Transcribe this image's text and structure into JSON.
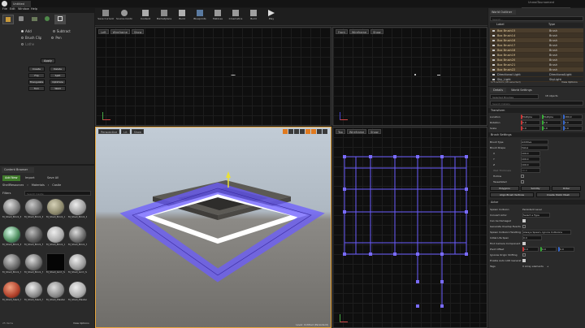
{
  "app": {
    "tab_title": "Untitled",
    "project_name": "UnrealTournament",
    "search_placeholder": "Search For Help"
  },
  "menu": [
    "File",
    "Edit",
    "Window",
    "Help"
  ],
  "toolbar": {
    "buttons": [
      "Save Current",
      "Source Control",
      "Content",
      "Marketplace",
      "Build",
      "Blueprints",
      "Matinee",
      "Cinematics",
      "Build",
      "Play"
    ]
  },
  "modes_panel": {
    "title": "Modes",
    "brush_options": [
      "Add",
      "Subtract",
      "Brush Clip",
      "Pen",
      "Lathe"
    ],
    "apply_label": "Apply",
    "buttons": [
      "Create",
      "Delete",
      "Flip",
      "Split",
      "Triangulate",
      "Optimize",
      "Turn",
      "Weld"
    ]
  },
  "content_browser": {
    "title": "Content Browser",
    "add_new_label": "Add New",
    "import_label": "Import",
    "save_all_label": "Save All",
    "path": [
      "ShellResources",
      "Materials",
      "Castle"
    ],
    "filters_label": "Filters",
    "search_placeholder": "Search Castle",
    "assets": [
      "M_Shell_Brick_B",
      "M_Shell_Brick_B",
      "M_Shell_Brick_C",
      "M_Shell_Brick_D",
      "M_Shell_Brick_E",
      "M_Shell_Brick_F",
      "M_Shell_Brick_G",
      "M_Shell_Brick_H",
      "M_Shell_Brick_Hpoptimize",
      "M_Shell_Brick_Stone",
      "M_Shell_Grnt_Slab_01",
      "M_Shell_Grnt_Slab_02",
      "M_Shell_Slant_Stab_01",
      "M_Shell_Slant_Slab_01_Sealed",
      "M_Shell_Plaster",
      "M_Shell_Plaster_Small",
      "M_Shell_Plaster",
      "M_Shell_Plaster_Stat",
      "M_Shell_Plaster",
      "M_Shell_Plaster_B"
    ],
    "item_count": "25 items",
    "view_options": "View Options"
  },
  "viewports": {
    "top_left": {
      "name": "Left",
      "mode": "Wireframe",
      "show": "Show"
    },
    "top_right": {
      "name": "Front",
      "mode": "Wireframe",
      "show": "Show"
    },
    "bottom_left": {
      "name": "Perspective",
      "mode": "Lit",
      "show": "Show",
      "level_text": "Level: Untitled (Persistent)"
    },
    "bottom_right": {
      "name": "Top",
      "mode": "Wireframe",
      "show": "Show"
    }
  },
  "world_outliner": {
    "title": "World Outliner",
    "search_placeholder": "Search...",
    "col_label": "Label",
    "col_type": "Type",
    "rows": [
      {
        "label": "Box Brush15",
        "type": "Brush"
      },
      {
        "label": "Box Brush14",
        "type": "Brush"
      },
      {
        "label": "Box Brush16",
        "type": "Brush"
      },
      {
        "label": "Box Brush17",
        "type": "Brush"
      },
      {
        "label": "Box Brush18",
        "type": "Brush"
      },
      {
        "label": "Box Brush19",
        "type": "Brush"
      },
      {
        "label": "Box Brush20",
        "type": "Brush"
      },
      {
        "label": "Box Brush21",
        "type": "Brush"
      },
      {
        "label": "Box Brush22",
        "type": "Brush"
      },
      {
        "label": "Directional Light",
        "type": "DirectionalLight"
      },
      {
        "label": "Sky_Light",
        "type": "SkyLight"
      }
    ],
    "count": "175 actors (18 selected)",
    "view_options": "View Options"
  },
  "details": {
    "tabs": [
      "Details",
      "World Settings"
    ],
    "selected": "Selected Brushes",
    "objects": "18 objects",
    "search_placeholder": "Search Details",
    "transform_title": "Transform",
    "location_label": "Location",
    "location": [
      "Multiple",
      "Multiple",
      "180.0"
    ],
    "rotation_label": "Rotation",
    "rotation": [
      "0.0",
      "0.0",
      "0.0"
    ],
    "scale_label": "Scale",
    "scale": [
      "1.0",
      "1.0",
      "1.0"
    ],
    "brush_settings_title": "Brush Settings",
    "brush_type_label": "Brush Type",
    "brush_type": "Additive",
    "brush_shape_label": "Brush Shape",
    "brush_shape": "Value",
    "x_label": "X",
    "x": "100.0",
    "y_label": "Y",
    "y": "100.0",
    "z_label": "Z",
    "z": "100.0",
    "wall_thickness_label": "Wall Thickness",
    "wall_thickness": "10.0",
    "hollow_label": "Hollow",
    "tessellated_label": "Tessellated",
    "polygons_label": "Polygons",
    "polygons_value": "Solidity",
    "order_value": "Order",
    "align_brush_label": "Align Brush Vertices",
    "create_static_mesh_label": "Create Static Mesh",
    "actor_title": "Actor",
    "rows": [
      {
        "label": "Spawn Collision",
        "value": "Persistent Level"
      },
      {
        "label": "Convert Actor",
        "value": "Select a Type"
      },
      {
        "label": "Can be Damaged",
        "value": ""
      },
      {
        "label": "Generate Overlap Events",
        "value": ""
      },
      {
        "label": "Spawn Collision Handling",
        "value": "Always Spawn, Ignore Collisions"
      },
      {
        "label": "Initial Life Span",
        "value": "0.0"
      },
      {
        "label": "Find Camera Component",
        "value": ""
      },
      {
        "label": "Pivot Offset",
        "value": ""
      },
      {
        "label": "Ignores Origin Shifting",
        "value": ""
      },
      {
        "label": "Enable Auto LOD Generat",
        "value": ""
      },
      {
        "label": "Tags",
        "value": "0 Array elements"
      }
    ],
    "pivot_offset": [
      "0.0",
      "0.0",
      "0.0"
    ]
  },
  "colors": {
    "accent_orange": "#e07a1f",
    "brush_blue": "#6b5cff",
    "outliner_row": "#4a3d2c"
  }
}
